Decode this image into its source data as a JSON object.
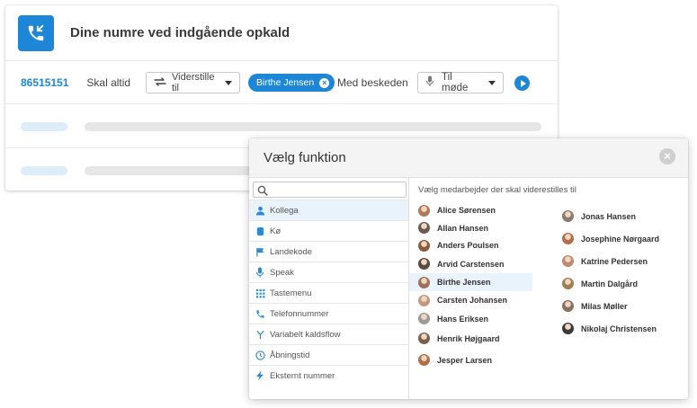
{
  "card": {
    "title": "Dine numre ved indgående opkald",
    "accent": "#1e86d6",
    "rule": {
      "number": "86515151",
      "condition": "Skal altid",
      "forward_select": "Viderstille til",
      "recipient_chip": "Birthe Jensen",
      "message_label": "Med beskeden",
      "message_select": "Til møde"
    }
  },
  "modal": {
    "title": "Vælg funktion",
    "search": {
      "placeholder": "",
      "value": ""
    },
    "functions": [
      {
        "label": "Kollega",
        "icon": "person-icon",
        "active": true
      },
      {
        "label": "Kø",
        "icon": "queue-icon",
        "active": false
      },
      {
        "label": "Landekode",
        "icon": "flag-icon",
        "active": false
      },
      {
        "label": "Speak",
        "icon": "microphone-icon",
        "active": false
      },
      {
        "label": "Tastemenu",
        "icon": "keypad-icon",
        "active": false
      },
      {
        "label": "Telefonnummer",
        "icon": "phone-icon",
        "active": false
      },
      {
        "label": "Variabelt kaldsflow",
        "icon": "branch-icon",
        "active": false
      },
      {
        "label": "Åbningstid",
        "icon": "clock-icon",
        "active": false
      },
      {
        "label": "Eksternt nummer",
        "icon": "lightning-icon",
        "active": false
      }
    ],
    "employees_caption": "Vælg medarbejder der skal viderestilles til",
    "employees_col1": [
      {
        "name": "Alice Sørensen",
        "color": "#b07a5a"
      },
      {
        "name": "Allan Hansen",
        "color": "#6b5a4e"
      },
      {
        "name": "Anders Poulsen",
        "color": "#8a5a3a"
      },
      {
        "name": "Arvid Carstensen",
        "color": "#5a4a3e"
      },
      {
        "name": "Birthe Jensen",
        "color": "#a0705a",
        "selected": true
      },
      {
        "name": "Carsten Johansen",
        "color": "#c09a80"
      },
      {
        "name": "Hans Eriksen",
        "color": "#9a9a9a"
      },
      {
        "name": "Henrik Højgaard",
        "color": "#7a6050"
      },
      {
        "name": "Jesper Larsen",
        "color": "#b0704a"
      }
    ],
    "employees_col2": [
      {
        "name": "Jonas Hansen",
        "color": "#8a7a70"
      },
      {
        "name": "Josephine Nørgaard",
        "color": "#b07050"
      },
      {
        "name": "Katrine Pedersen",
        "color": "#c08a70"
      },
      {
        "name": "Martin Dalgård",
        "color": "#a08050"
      },
      {
        "name": "Milas Møller",
        "color": "#8a7060"
      },
      {
        "name": "Nikolaj Christensen",
        "color": "#3a3a3a"
      }
    ]
  }
}
